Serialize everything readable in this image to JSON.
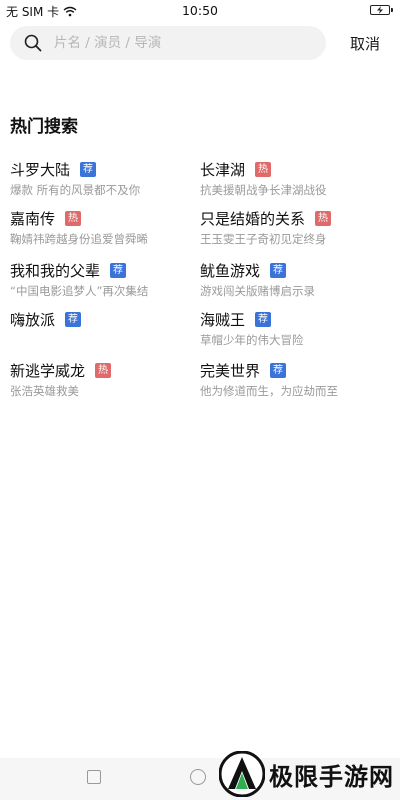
{
  "status_bar": {
    "carrier": "无 SIM 卡",
    "time": "10:50"
  },
  "search": {
    "placeholder": "片名 / 演员 / 导演",
    "value": "",
    "cancel_label": "取消"
  },
  "hot_search": {
    "title": "热门搜索",
    "items": [
      {
        "title": "斗罗大陆",
        "tag": "荐",
        "tag_type": "rec",
        "subtitle": "爆款 所有的风景都不及你"
      },
      {
        "title": "长津湖",
        "tag": "热",
        "tag_type": "hot",
        "subtitle": "抗美援朝战争长津湖战役"
      },
      {
        "title": "嘉南传",
        "tag": "热",
        "tag_type": "hot",
        "subtitle": "鞠婧祎跨越身份追爱曾舜晞"
      },
      {
        "title": "只是结婚的关系",
        "tag": "热",
        "tag_type": "hot",
        "subtitle": "王玉雯王子奇初见定终身"
      },
      {
        "title": "我和我的父辈",
        "tag": "荐",
        "tag_type": "rec",
        "subtitle": "“中国电影追梦人”再次集结"
      },
      {
        "title": "鱿鱼游戏",
        "tag": "荐",
        "tag_type": "rec",
        "subtitle": "游戏闯关版赌博启示录"
      },
      {
        "title": "嗨放派",
        "tag": "荐",
        "tag_type": "rec",
        "subtitle": ""
      },
      {
        "title": "海贼王",
        "tag": "荐",
        "tag_type": "rec",
        "subtitle": "草帽少年的伟大冒险"
      },
      {
        "title": "新逃学威龙",
        "tag": "热",
        "tag_type": "hot",
        "subtitle": "张浩英雄救美"
      },
      {
        "title": "完美世界",
        "tag": "荐",
        "tag_type": "rec",
        "subtitle": "他为修道而生，为应劫而至"
      }
    ]
  },
  "watermark": {
    "text": "极限手游网"
  },
  "colors": {
    "tag_rec": "#3b73d9",
    "tag_hot": "#e06a6a",
    "search_bg": "#f2f2f2"
  }
}
